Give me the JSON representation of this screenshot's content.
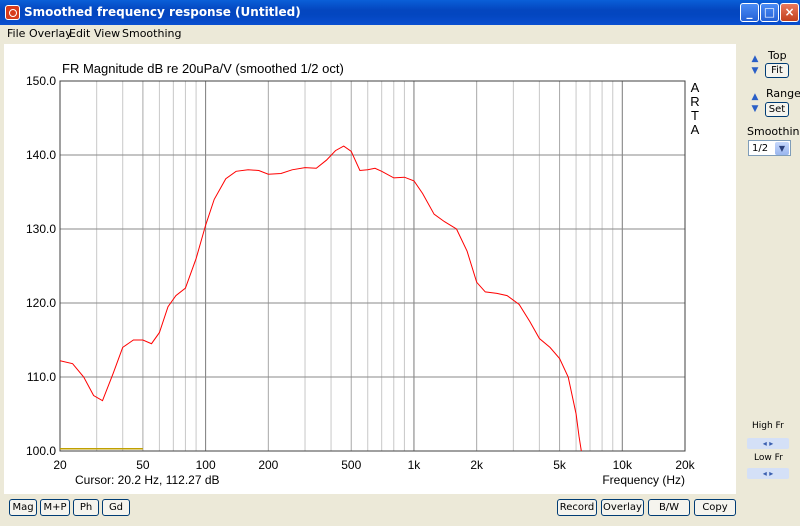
{
  "window": {
    "title": "Smoothed frequency response (Untitled)"
  },
  "menu": [
    "File",
    "Overlay",
    "Edit",
    "View",
    "Smoothing"
  ],
  "controls": {
    "top_label": "Top",
    "fit_label": "Fit",
    "range_label": "Range",
    "set_label": "Set",
    "smoothing_label": "Smoothing",
    "smoothing_value": "1/2",
    "high_fr_label": "High Fr",
    "low_fr_label": "Low Fr"
  },
  "bottom_buttons": {
    "left": [
      "Mag",
      "M+P",
      "Ph",
      "Gd"
    ],
    "right": [
      "Record",
      "Overlay",
      "B/W",
      "Copy"
    ]
  },
  "plot": {
    "cursor": "Cursor: 20.2 Hz, 112.27 dB",
    "watermark": "A\nR\nT\nA"
  },
  "chart_data": {
    "type": "line",
    "title": "FR Magnitude dB re 20uPa/V (smoothed 1/2 oct)",
    "xlabel": "Frequency (Hz)",
    "ylabel": "",
    "x_scale": "log",
    "xlim": [
      20,
      20000
    ],
    "ylim": [
      100,
      150
    ],
    "x_ticks": [
      20,
      50,
      100,
      200,
      500,
      1000,
      2000,
      5000,
      10000,
      20000
    ],
    "x_tick_labels": [
      "20",
      "50",
      "100",
      "200",
      "500",
      "1k",
      "2k",
      "5k",
      "10k",
      "20k"
    ],
    "y_ticks": [
      100,
      110,
      120,
      130,
      140,
      150
    ],
    "y_tick_labels": [
      "100.0",
      "110.0",
      "120.0",
      "130.0",
      "140.0",
      "150.0"
    ],
    "grid": true,
    "series": [
      {
        "color": "#ff0000",
        "x": [
          20,
          23,
          26,
          29,
          32,
          36,
          40,
          45,
          50,
          55,
          60,
          66,
          72,
          80,
          90,
          100,
          110,
          125,
          140,
          160,
          180,
          200,
          230,
          260,
          300,
          340,
          380,
          420,
          460,
          500,
          550,
          600,
          650,
          700,
          800,
          900,
          1000,
          1100,
          1250,
          1400,
          1600,
          1800,
          2000,
          2200,
          2500,
          2800,
          3200,
          3600,
          4000,
          4500,
          5000,
          5500,
          6000,
          6200,
          6400,
          6500
        ],
        "y": [
          112.2,
          111.8,
          110.0,
          107.5,
          106.8,
          110.5,
          114.0,
          115.0,
          115.0,
          114.5,
          116.0,
          119.5,
          121.0,
          122.0,
          126.0,
          130.5,
          134.0,
          136.8,
          137.8,
          138.0,
          137.9,
          137.4,
          137.5,
          138.0,
          138.3,
          138.2,
          139.3,
          140.6,
          141.2,
          140.5,
          137.9,
          138.0,
          138.2,
          137.8,
          136.9,
          137.0,
          136.5,
          134.8,
          132.0,
          131.0,
          130.0,
          127.0,
          122.8,
          121.5,
          121.3,
          121.0,
          119.8,
          117.5,
          115.2,
          114.0,
          112.5,
          110.0,
          105.0,
          102.0,
          99.5,
          98.0
        ]
      },
      {
        "color": "#c0a000",
        "x": [
          20,
          50
        ],
        "y": [
          100.3,
          100.3
        ]
      }
    ]
  }
}
